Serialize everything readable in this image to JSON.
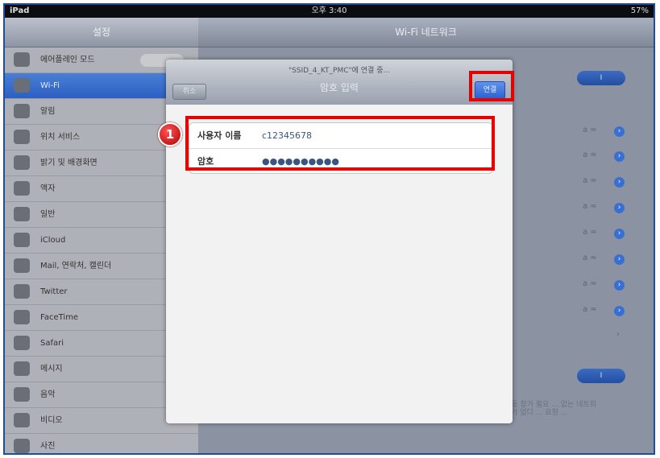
{
  "statusbar": {
    "device": "iPad",
    "time": "오후 3:40",
    "battery": "57%"
  },
  "settings": {
    "title": "설정",
    "items": [
      {
        "label": "에어플레인 모드",
        "icon": "airplane-icon"
      },
      {
        "label": "Wi-Fi",
        "icon": "wifi-icon",
        "selected": true
      },
      {
        "label": "알림",
        "icon": "notification-icon"
      },
      {
        "label": "위치 서비스",
        "icon": "location-icon"
      },
      {
        "label": "밝기 및 배경화면",
        "icon": "brightness-icon"
      },
      {
        "label": "액자",
        "icon": "picture-frame-icon"
      },
      {
        "label": "일반",
        "icon": "gear-icon"
      },
      {
        "label": "iCloud",
        "icon": "cloud-icon"
      },
      {
        "label": "Mail, 연락처, 캘린더",
        "icon": "mail-icon"
      },
      {
        "label": "Twitter",
        "icon": "twitter-icon"
      },
      {
        "label": "FaceTime",
        "icon": "facetime-icon"
      },
      {
        "label": "Safari",
        "icon": "safari-icon"
      },
      {
        "label": "메시지",
        "icon": "message-icon"
      },
      {
        "label": "음악",
        "icon": "music-icon"
      },
      {
        "label": "비디오",
        "icon": "video-icon"
      },
      {
        "label": "사진",
        "icon": "photos-icon"
      }
    ]
  },
  "wifi": {
    "title": "Wi-Fi 네트워크",
    "toggle_label": "I",
    "footnote": "수동 참가 필요 ... 없는 네트워크가 없다 ... 요청 ..."
  },
  "dialog": {
    "network": "\"SSID_4_KT_PMC\"에 연결 중...",
    "title": "암호 입력",
    "cancel_label": "취소",
    "join_label": "연결",
    "username_label": "사용자 이름",
    "username_value": "c12345678",
    "password_label": "암호",
    "password_value": "●●●●●●●●●●"
  },
  "callout": {
    "number": "1"
  },
  "colors": {
    "highlight": "#e60000",
    "accent": "#2c62d1"
  }
}
